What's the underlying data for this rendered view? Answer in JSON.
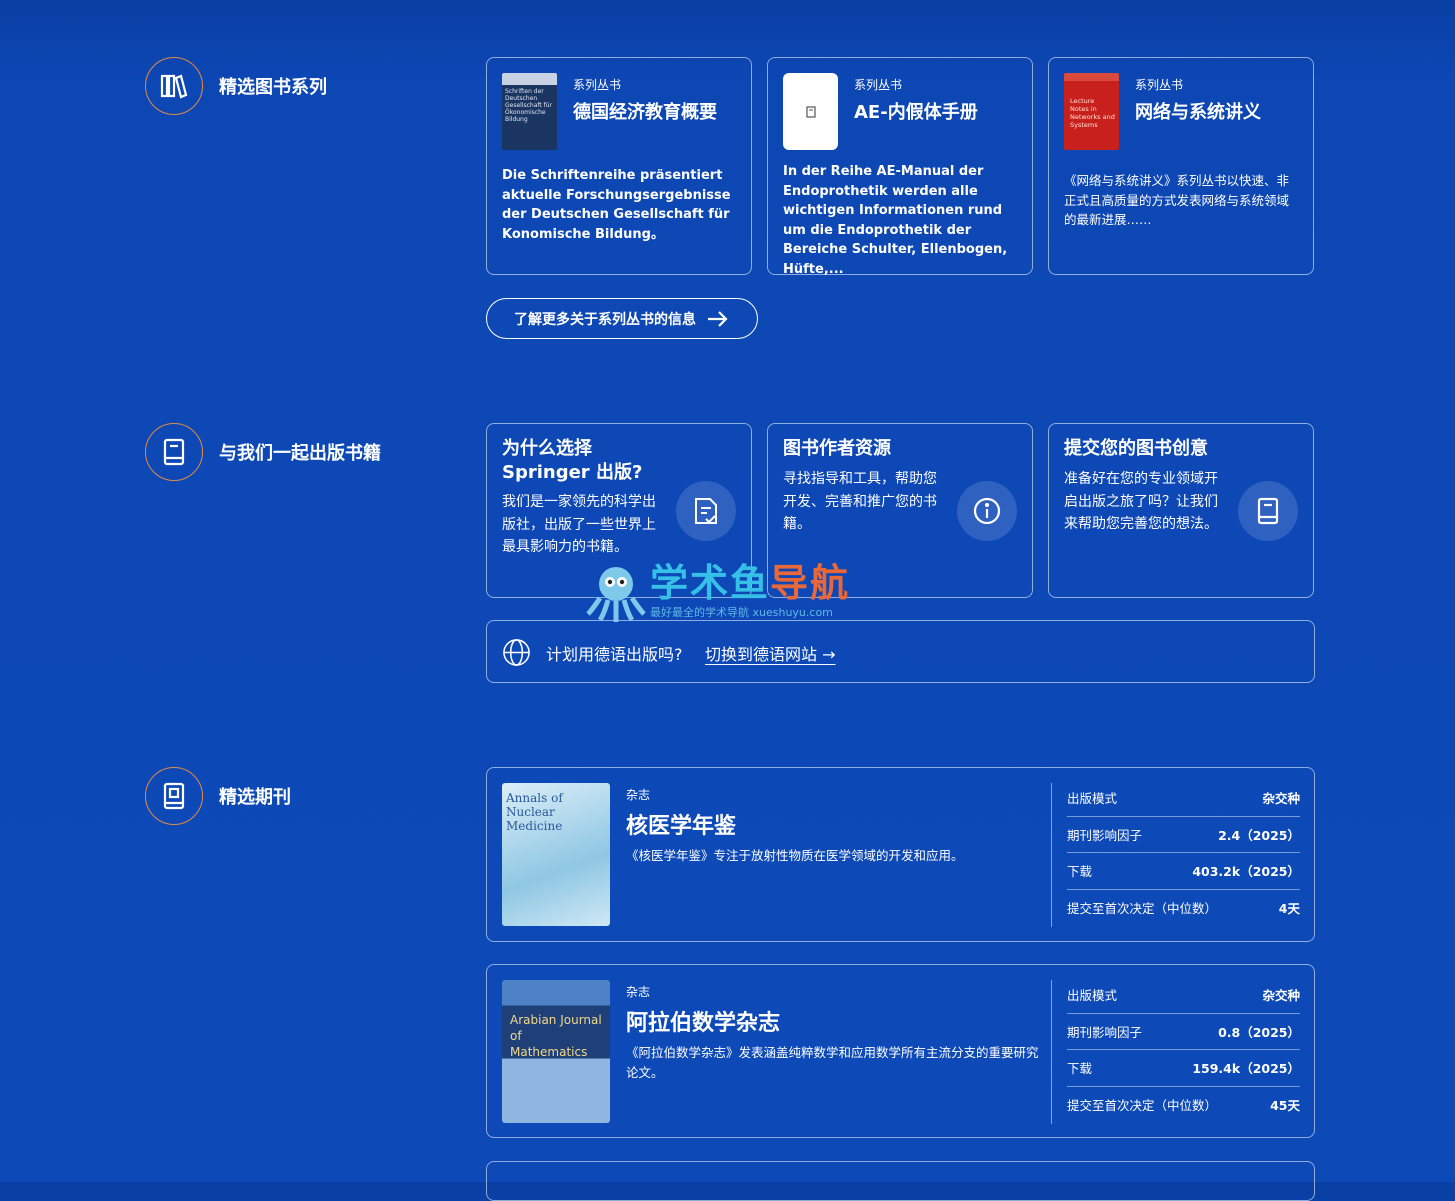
{
  "series_section": {
    "title": "精选图书系列",
    "cards": [
      {
        "kicker": "系列丛书",
        "title": "德国经济教育概要",
        "cover_text": "Schriften der Deutschen Gesellschaft für Ökonomische Bildung",
        "description": "Die Schriftenreihe präsentiert aktuelle Forschungsergebnisse der Deutschen Gesellschaft für Konomische Bildung。"
      },
      {
        "kicker": "系列丛书",
        "title": "AE-内假体手册",
        "description": "In der Reihe AE-Manual der Endoprothetik werden alle wichtigen Informationen rund um die Endoprothetik der Bereiche Schulter, Ellenbogen, Hüfte,..."
      },
      {
        "kicker": "系列丛书",
        "title": "网络与系统讲义",
        "cover_text": "Lecture Notes in Networks and Systems",
        "description": "《网络与系统讲义》系列丛书以快速、非正式且高质量的方式发表网络与系统领域的最新进展……"
      }
    ],
    "more_button": "了解更多关于系列丛书的信息"
  },
  "publish_section": {
    "title": "与我们一起出版书籍",
    "cards": [
      {
        "title": "为什么选择 Springer 出版?",
        "description": "我们是一家领先的科学出版社，出版了一些世界上最具影响力的书籍。",
        "icon": "document-check-icon"
      },
      {
        "title": "图书作者资源",
        "description": "寻找指导和工具，帮助您开发、完善和推广您的书籍。",
        "icon": "info-icon"
      },
      {
        "title": "提交您的图书创意",
        "description": "准备好在您的专业领域开启出版之旅了吗？让我们来帮助您完善您的想法。",
        "icon": "book-icon"
      }
    ],
    "lang_question": "计划用德语出版吗?",
    "lang_link": "切换到德语网站"
  },
  "journals_section": {
    "title": "精选期刊",
    "journals": [
      {
        "kicker": "杂志",
        "title": "核医学年鉴",
        "cover_text": "Annals of Nuclear Medicine",
        "description": "《核医学年鉴》专注于放射性物质在医学领域的开发和应用。",
        "metrics": [
          {
            "label": "出版模式",
            "value": "杂交种"
          },
          {
            "label": "期刊影响因子",
            "value": "2.4（2025）"
          },
          {
            "label": "下载",
            "value": "403.2k（2025）"
          },
          {
            "label": "提交至首次决定（中位数）",
            "value": "4天"
          }
        ]
      },
      {
        "kicker": "杂志",
        "title": "阿拉伯数学杂志",
        "cover_text": "Arabian Journal of Mathematics",
        "description": "《阿拉伯数学杂志》发表涵盖纯粹数学和应用数学所有主流分支的重要研究论文。",
        "metrics": [
          {
            "label": "出版模式",
            "value": "杂交种"
          },
          {
            "label": "期刊影响因子",
            "value": "0.8（2025）"
          },
          {
            "label": "下载",
            "value": "159.4k（2025）"
          },
          {
            "label": "提交至首次决定（中位数）",
            "value": "45天"
          }
        ]
      }
    ]
  },
  "watermark": {
    "title_a": "学术鱼",
    "title_b": "导航",
    "subtitle": "最好最全的学术导航 xueshuyu.com"
  }
}
